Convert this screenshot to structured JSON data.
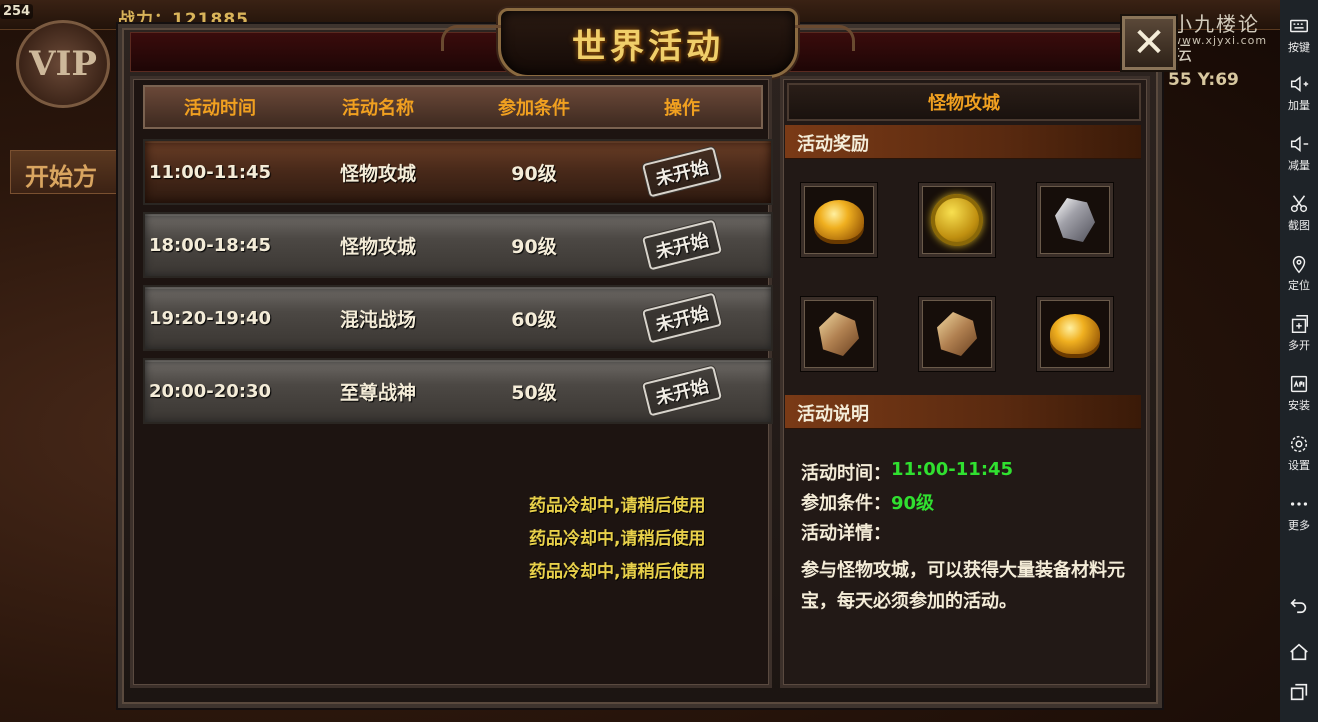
{
  "hud": {
    "level": "254",
    "power": "战力：121885",
    "vip": "VIP",
    "left_banner": "开始方",
    "coords": "55 Y:69",
    "watermark": "小九楼论坛",
    "watermark_url": "www.xjyxi.com"
  },
  "dialog": {
    "title": "世界活动",
    "close_label": "✕"
  },
  "table": {
    "headers": [
      "活动时间",
      "活动名称",
      "参加条件",
      "操作"
    ],
    "rows": [
      {
        "time": "11:00-11:45",
        "name": "怪物攻城",
        "condition": "90级",
        "action": "未开始",
        "selected": true
      },
      {
        "time": "18:00-18:45",
        "name": "怪物攻城",
        "condition": "90级",
        "action": "未开始",
        "selected": false
      },
      {
        "time": "19:20-19:40",
        "name": "混沌战场",
        "condition": "60级",
        "action": "未开始",
        "selected": false
      },
      {
        "time": "20:00-20:30",
        "name": "至尊战神",
        "condition": "50级",
        "action": "未开始",
        "selected": false
      }
    ]
  },
  "messages": [
    "药品冷却中,请稍后使用",
    "药品冷却中,请稍后使用",
    "药品冷却中,请稍后使用"
  ],
  "detail": {
    "title": "怪物攻城",
    "rewards_header": "活动奖励",
    "rewards": [
      "gold-ingot-icon",
      "gold-coin-icon",
      "silver-crystal-icon",
      "ore-fragment-icon",
      "ore-chunk-icon",
      "gold-ingot-icon"
    ],
    "desc_header": "活动说明",
    "time_label": "活动时间：",
    "time_value": "11:00-11:45",
    "cond_label": "参加条件：",
    "cond_value": "90级",
    "detail_label": "活动详情：",
    "description": "参与怪物攻城，可以获得大量装备材料元宝，每天必须参加的活动。"
  },
  "sidebar": [
    {
      "label": "按键",
      "icon": "keyboard-icon"
    },
    {
      "label": "加量",
      "icon": "volume-up-icon"
    },
    {
      "label": "减量",
      "icon": "volume-down-icon"
    },
    {
      "label": "截图",
      "icon": "scissors-icon"
    },
    {
      "label": "定位",
      "icon": "location-pin-icon"
    },
    {
      "label": "多开",
      "icon": "multi-window-icon"
    },
    {
      "label": "安装",
      "icon": "apk-install-icon"
    },
    {
      "label": "设置",
      "icon": "gear-icon"
    },
    {
      "label": "更多",
      "icon": "more-dots-icon"
    }
  ],
  "colors": {
    "accent": "#f0a020",
    "value_green": "#30e030",
    "message_yellow": "#e8d04a"
  }
}
